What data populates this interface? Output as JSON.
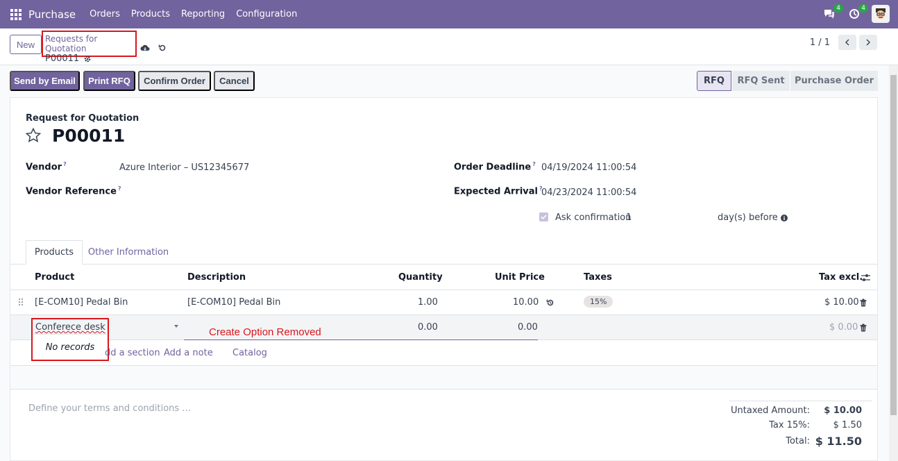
{
  "navbar": {
    "app_name": "Purchase",
    "menu": [
      "Orders",
      "Products",
      "Reporting",
      "Configuration"
    ],
    "messages_count": "4",
    "activities_count": "4",
    "icons": [
      "apps-grid-icon",
      "chat-icon",
      "clock-icon",
      "avatar-icon"
    ]
  },
  "control_panel": {
    "new_label": "New",
    "breadcrumb_parent": "Requests for Quotation",
    "breadcrumb_current": "P00011",
    "pager_value": "1 / 1"
  },
  "actions": {
    "send_by_email": "Send by Email",
    "print_rfq": "Print RFQ",
    "confirm_order": "Confirm Order",
    "cancel": "Cancel"
  },
  "status": {
    "stages": [
      "RFQ",
      "RFQ Sent",
      "Purchase Order"
    ],
    "active": "RFQ"
  },
  "form": {
    "header_label": "Request for Quotation",
    "name": "P00011",
    "vendor_label": "Vendor",
    "vendor_value": "Azure Interior – US12345677",
    "vendor_ref_label": "Vendor Reference",
    "order_deadline_label": "Order Deadline",
    "order_deadline_value": "04/19/2024 11:00:54",
    "expected_arrival_label": "Expected Arrival",
    "expected_arrival_value": "04/23/2024 11:00:54",
    "ask_confirmation_label": "Ask confirmation",
    "ask_confirmation_days": "1",
    "days_before_label": "day(s) before",
    "help_mark": "?"
  },
  "tabs": [
    "Products",
    "Other Information"
  ],
  "table": {
    "columns": [
      "Product",
      "Description",
      "Quantity",
      "Unit Price",
      "Taxes",
      "Tax excl."
    ],
    "rows": [
      {
        "product": "[E-COM10] Pedal Bin",
        "description": "[E-COM10] Pedal Bin",
        "quantity": "1.00",
        "unit_price": "10.00",
        "tax": "15%",
        "tax_excl": "$ 10.00"
      }
    ],
    "editing_row": {
      "product_input": "Conferece desk",
      "quantity": "0.00",
      "unit_price": "0.00",
      "tax_excl": "$ 0.00",
      "dropdown_message": "No records"
    },
    "links": {
      "add_section": "dd a section",
      "add_note": "Add a note",
      "catalog": "Catalog"
    }
  },
  "annotation": "Create Option Removed",
  "terms_placeholder": "Define your terms and conditions ...",
  "totals": {
    "untaxed_label": "Untaxed Amount:",
    "untaxed_value": "$ 10.00",
    "tax_label": "Tax 15%:",
    "tax_value": "$ 1.50",
    "total_label": "Total:",
    "total_value": "$ 11.50"
  },
  "colors": {
    "brand": "#71639e",
    "highlight_annotation": "#d9161c"
  }
}
